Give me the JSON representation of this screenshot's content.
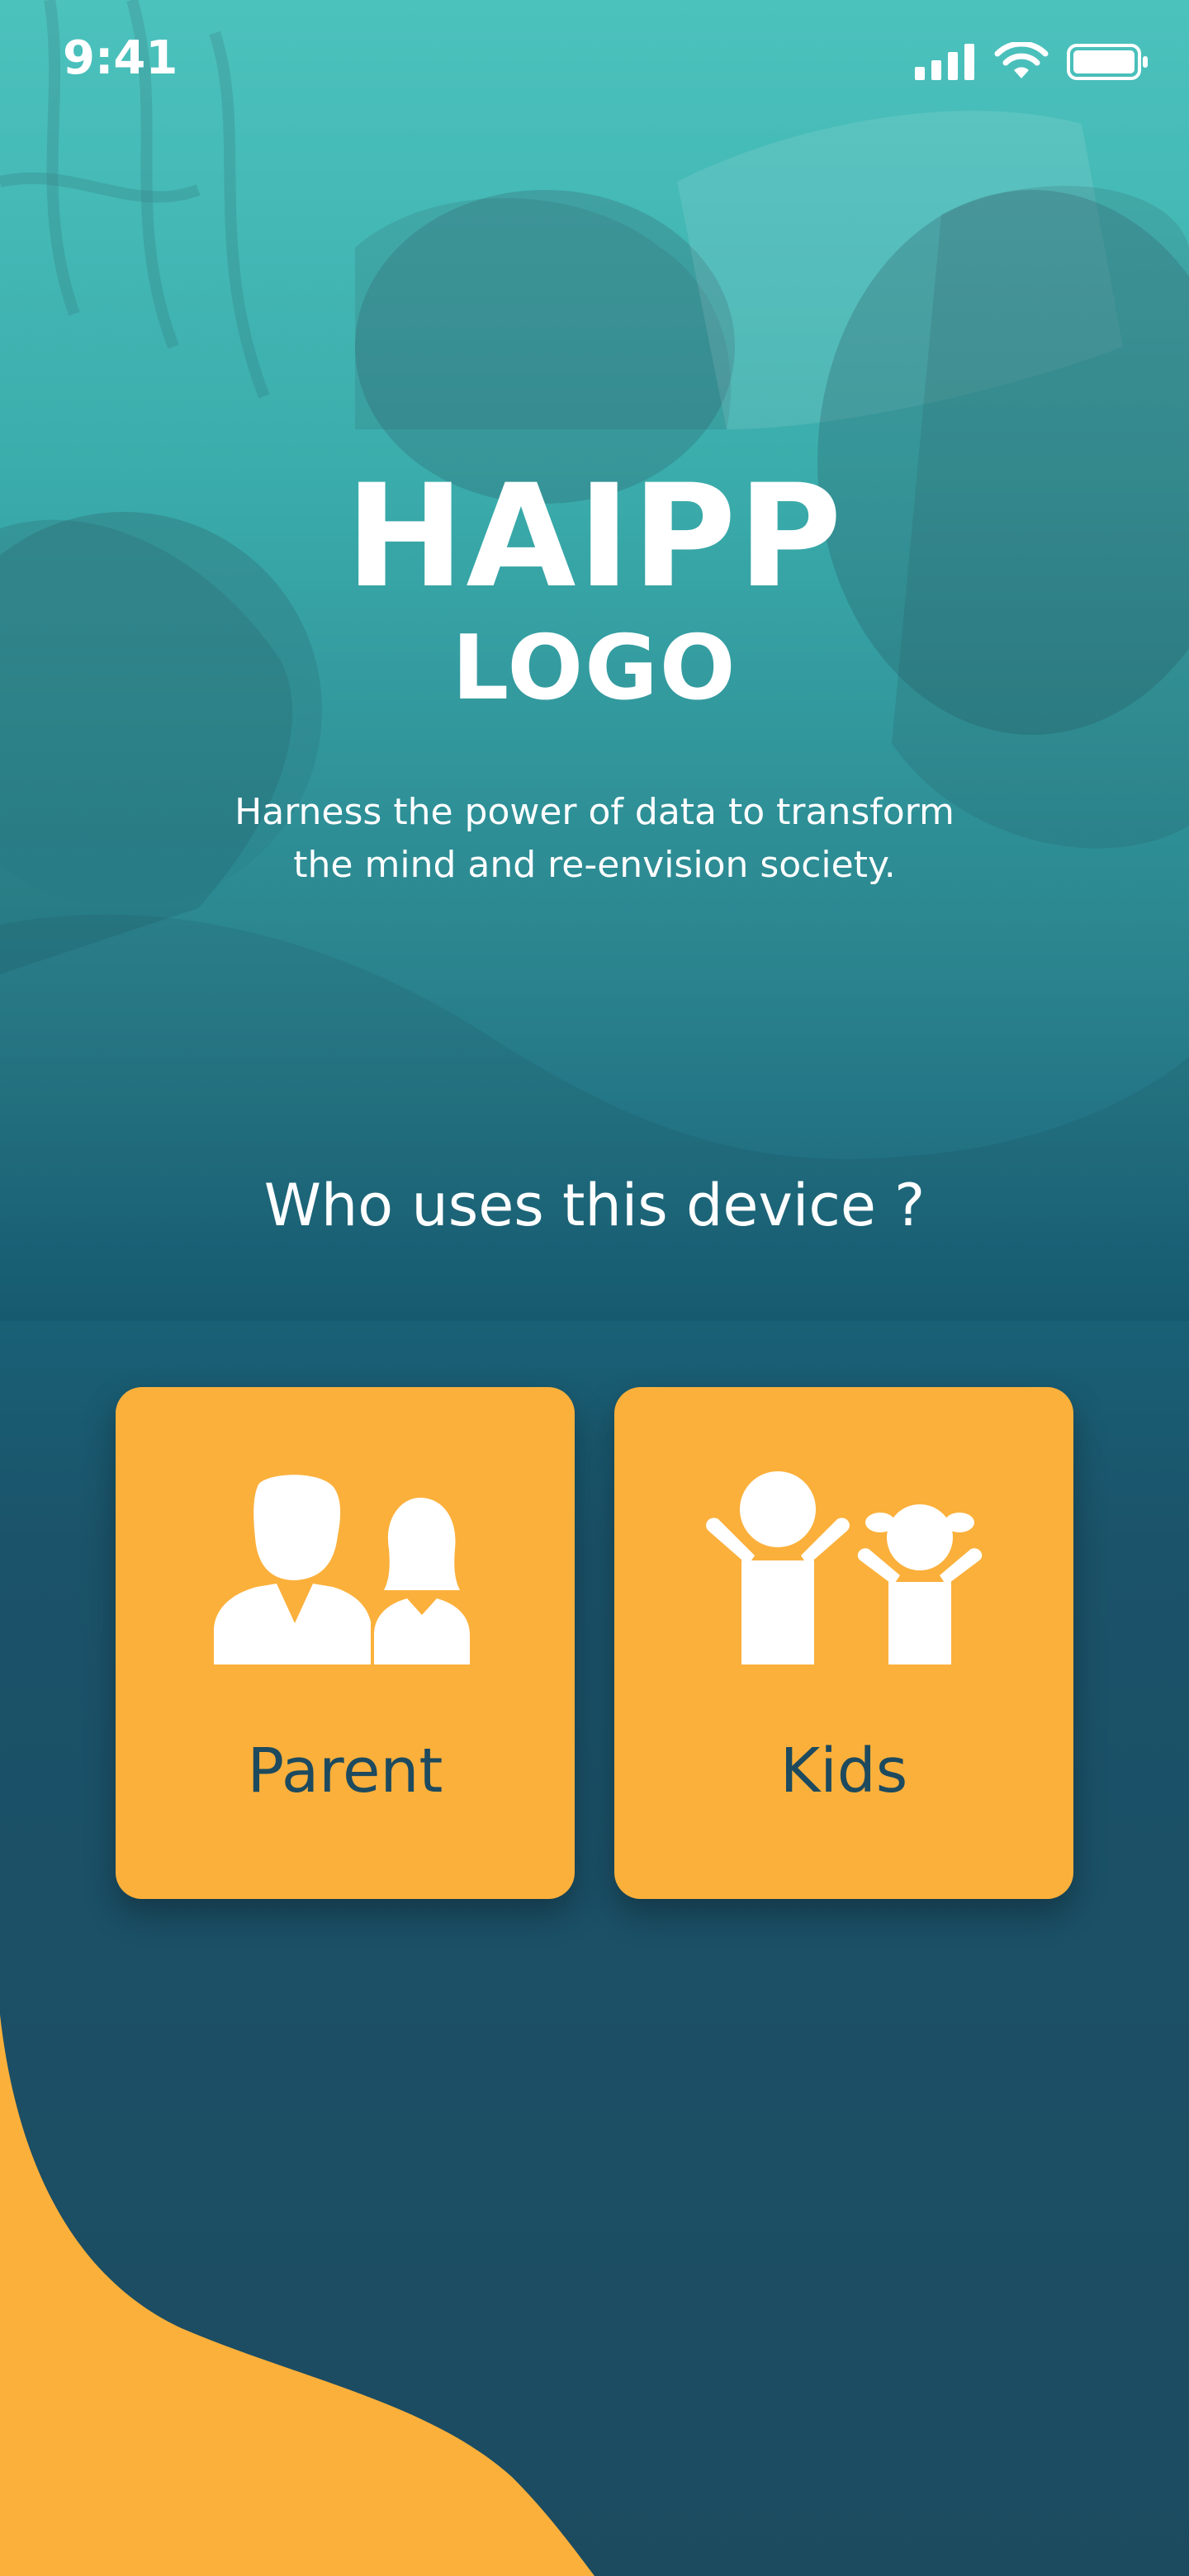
{
  "status_bar": {
    "time": "9:41",
    "icons": [
      "signal-icon",
      "wifi-icon",
      "battery-icon"
    ]
  },
  "hero": {
    "title": "HAIPP",
    "subtitle": "LOGO",
    "tagline_line1": "Harness the power of data to transform",
    "tagline_line2": "the mind and re-envision society."
  },
  "question": "Who uses this device ?",
  "options": [
    {
      "label": "Parent",
      "icon": "parent-couple-icon"
    },
    {
      "label": "Kids",
      "icon": "kids-icon"
    }
  ],
  "colors": {
    "teal_top": "#1fb3ad",
    "navy_bottom": "#1c4b60",
    "card_orange": "#fbb03b",
    "card_text": "#1d4a5e",
    "wave_orange": "#fbb03b",
    "text_white": "#ffffff"
  }
}
